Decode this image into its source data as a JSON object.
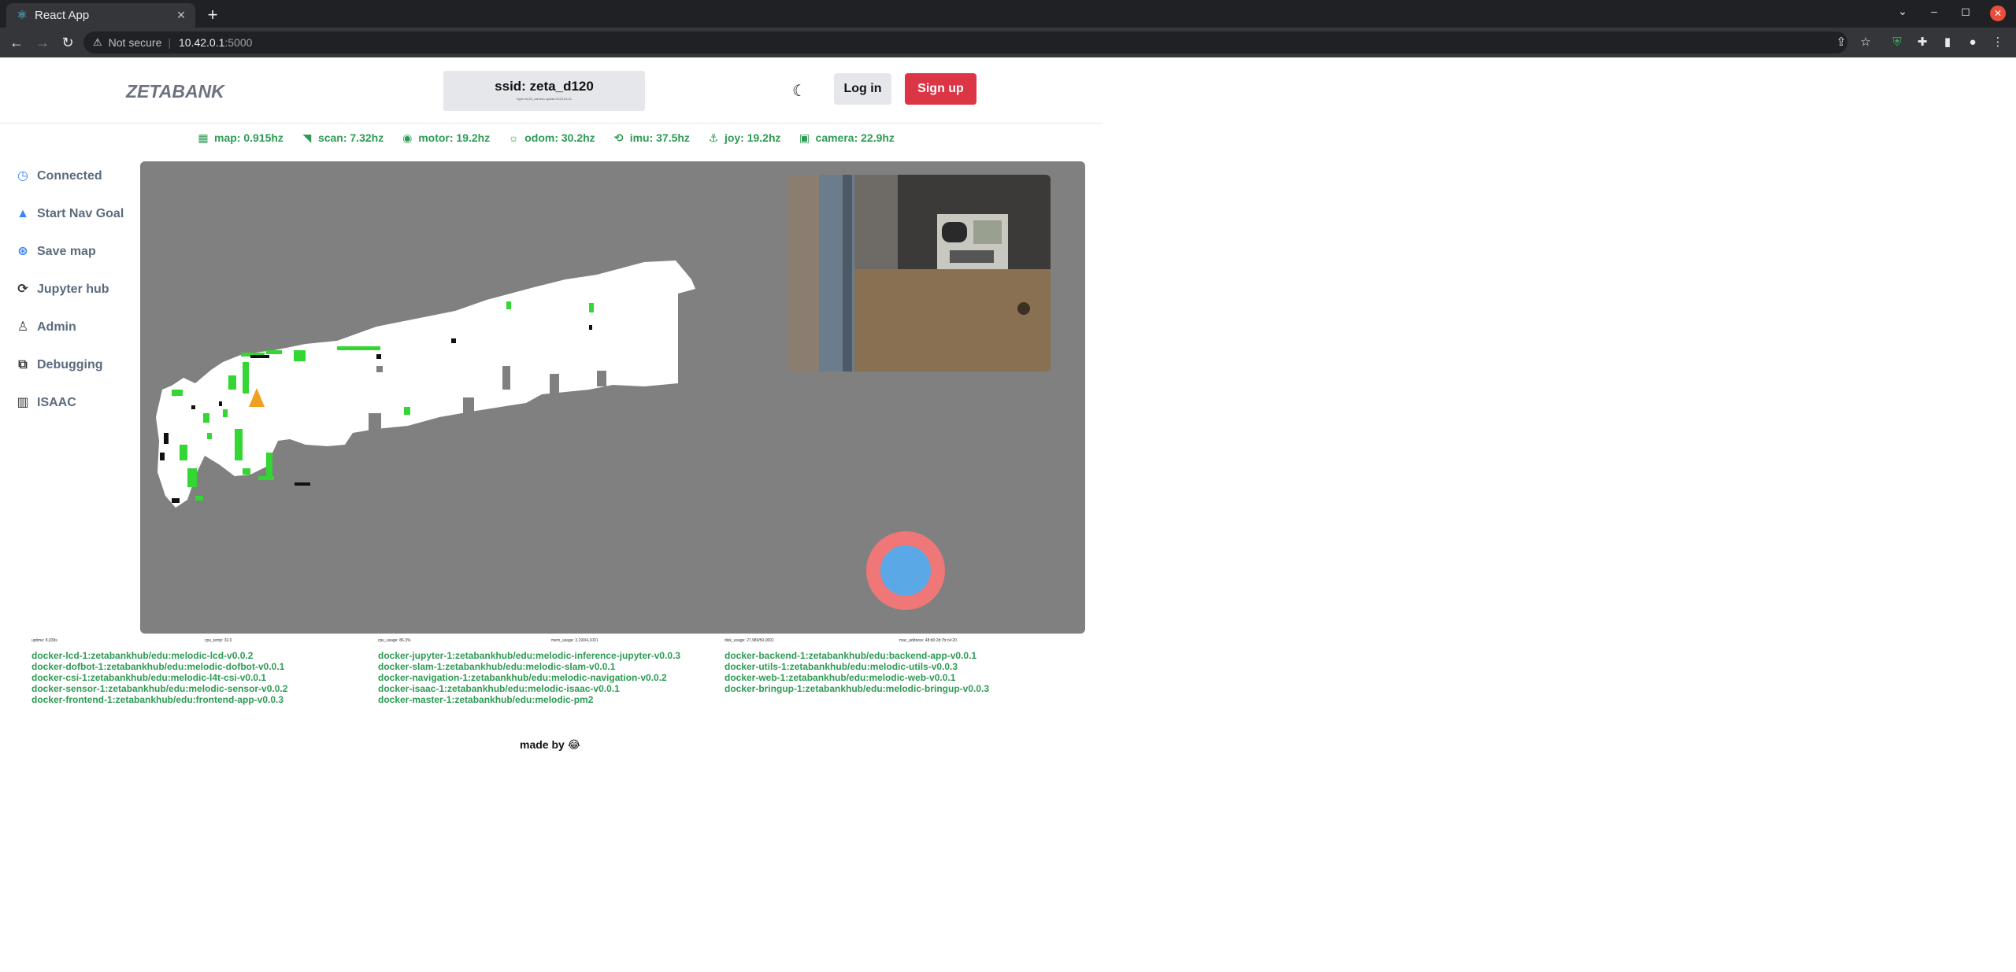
{
  "browser": {
    "tab_title": "React App",
    "tab_icon": "react-icon",
    "new_tab": "+",
    "url_host": "10.42.0.1",
    "url_port": ":5000",
    "security_label": "Not secure",
    "window_controls": [
      "–",
      "◻",
      "✕"
    ]
  },
  "header": {
    "logo": "ZETABANK",
    "ssid": "ssid: zeta_d120",
    "ssid_sub": "hyper:d120_camera update:2023.03.21",
    "theme_icon": "moon-icon",
    "login_label": "Log in",
    "signup_label": "Sign up"
  },
  "status": [
    {
      "label": "map: 0.915hz",
      "icon": "grid-icon"
    },
    {
      "label": "scan: 7.32hz",
      "icon": "wifi-icon"
    },
    {
      "label": "motor: 19.2hz",
      "icon": "motor-icon"
    },
    {
      "label": "odom: 30.2hz",
      "icon": "sun-icon"
    },
    {
      "label": "imu: 37.5hz",
      "icon": "imu-icon"
    },
    {
      "label": "joy: 19.2hz",
      "icon": "joystick-icon"
    },
    {
      "label": "camera: 22.9hz",
      "icon": "camera-icon"
    }
  ],
  "sidebar": {
    "items": [
      {
        "label": "Connected",
        "icon": "connected-icon"
      },
      {
        "label": "Start Nav Goal",
        "icon": "navigation-icon"
      },
      {
        "label": "Save map",
        "icon": "save-map-icon"
      },
      {
        "label": "Jupyter hub",
        "icon": "jupyter-icon"
      },
      {
        "label": "Admin",
        "icon": "user-icon"
      },
      {
        "label": "Debugging",
        "icon": "debug-icon"
      },
      {
        "label": "ISAAC",
        "icon": "chart-icon"
      }
    ]
  },
  "sysinfo": [
    "uptime: 8,039s",
    "cpu_temp: 32.0",
    "cpu_usage: 86.3%",
    "mem_usage: 3,190/4,1001",
    "disk_usage: 27,989/50,0001",
    "mac_address: 48:b0:2d:7b:c4:20"
  ],
  "docker": {
    "col1": [
      "docker-lcd-1:zetabankhub/edu:melodic-lcd-v0.0.2",
      "docker-dofbot-1:zetabankhub/edu:melodic-dofbot-v0.0.1",
      "docker-csi-1:zetabankhub/edu:melodic-l4t-csi-v0.0.1",
      "docker-sensor-1:zetabankhub/edu:melodic-sensor-v0.0.2",
      "docker-frontend-1:zetabankhub/edu:frontend-app-v0.0.3"
    ],
    "col2": [
      "docker-jupyter-1:zetabankhub/edu:melodic-inference-jupyter-v0.0.3",
      "docker-slam-1:zetabankhub/edu:melodic-slam-v0.0.1",
      "docker-navigation-1:zetabankhub/edu:melodic-navigation-v0.0.2",
      "docker-isaac-1:zetabankhub/edu:melodic-isaac-v0.0.1",
      "docker-master-1:zetabankhub/edu:melodic-pm2"
    ],
    "col3": [
      "docker-backend-1:zetabankhub/edu:backend-app-v0.0.1",
      "docker-utils-1:zetabankhub/edu:melodic-utils-v0.0.3",
      "docker-web-1:zetabankhub/edu:melodic-web-v0.0.1",
      "docker-bringup-1:zetabankhub/edu:melodic-bringup-v0.0.3"
    ]
  },
  "footer": {
    "made_by": "made by 😂"
  },
  "colors": {
    "status_green": "#2e9b55",
    "signup_red": "#dc3545",
    "map_bg": "#808080",
    "joystick_outer": "#f07777",
    "joystick_inner": "#5aa9e6"
  }
}
